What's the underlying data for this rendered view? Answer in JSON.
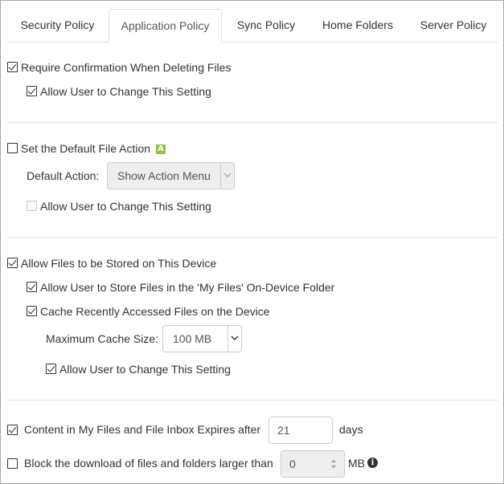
{
  "tabs": [
    {
      "label": "Security Policy",
      "active": false
    },
    {
      "label": "Application Policy",
      "active": true
    },
    {
      "label": "Sync Policy",
      "active": false
    },
    {
      "label": "Home Folders",
      "active": false
    },
    {
      "label": "Server Policy",
      "active": false
    }
  ],
  "sections": {
    "confirm_delete": {
      "label": "Require Confirmation When Deleting Files",
      "checked": true,
      "allow_change_label": "Allow User to Change This Setting",
      "allow_change_checked": true
    },
    "default_action": {
      "label": "Set the Default File Action",
      "checked": false,
      "badge": "A",
      "badge_icon": "android-badge-icon",
      "action_label": "Default Action:",
      "action_value": "Show Action Menu",
      "allow_change_label": "Allow User to Change This Setting",
      "allow_change_checked": false
    },
    "store_files": {
      "label": "Allow Files to be Stored on This Device",
      "checked": true,
      "my_files_label": "Allow User to Store Files in the 'My Files' On-Device Folder",
      "my_files_checked": true,
      "cache_label": "Cache Recently Accessed Files on the Device",
      "cache_checked": true,
      "cache_size_label": "Maximum Cache Size:",
      "cache_size_value": "100 MB",
      "allow_change_label": "Allow User to Change This Setting",
      "allow_change_checked": true
    },
    "expiry": {
      "label": "Content in My Files and File Inbox Expires after",
      "checked": true,
      "value": "21",
      "unit": "days"
    },
    "block_download": {
      "label": "Block the download of files and folders larger than",
      "checked": false,
      "value": "0",
      "unit": "MB",
      "info_icon": "info-icon"
    }
  },
  "colors": {
    "badge": "#8dc63f",
    "border": "#dddddd",
    "disabled_bg": "#eeeeee"
  }
}
